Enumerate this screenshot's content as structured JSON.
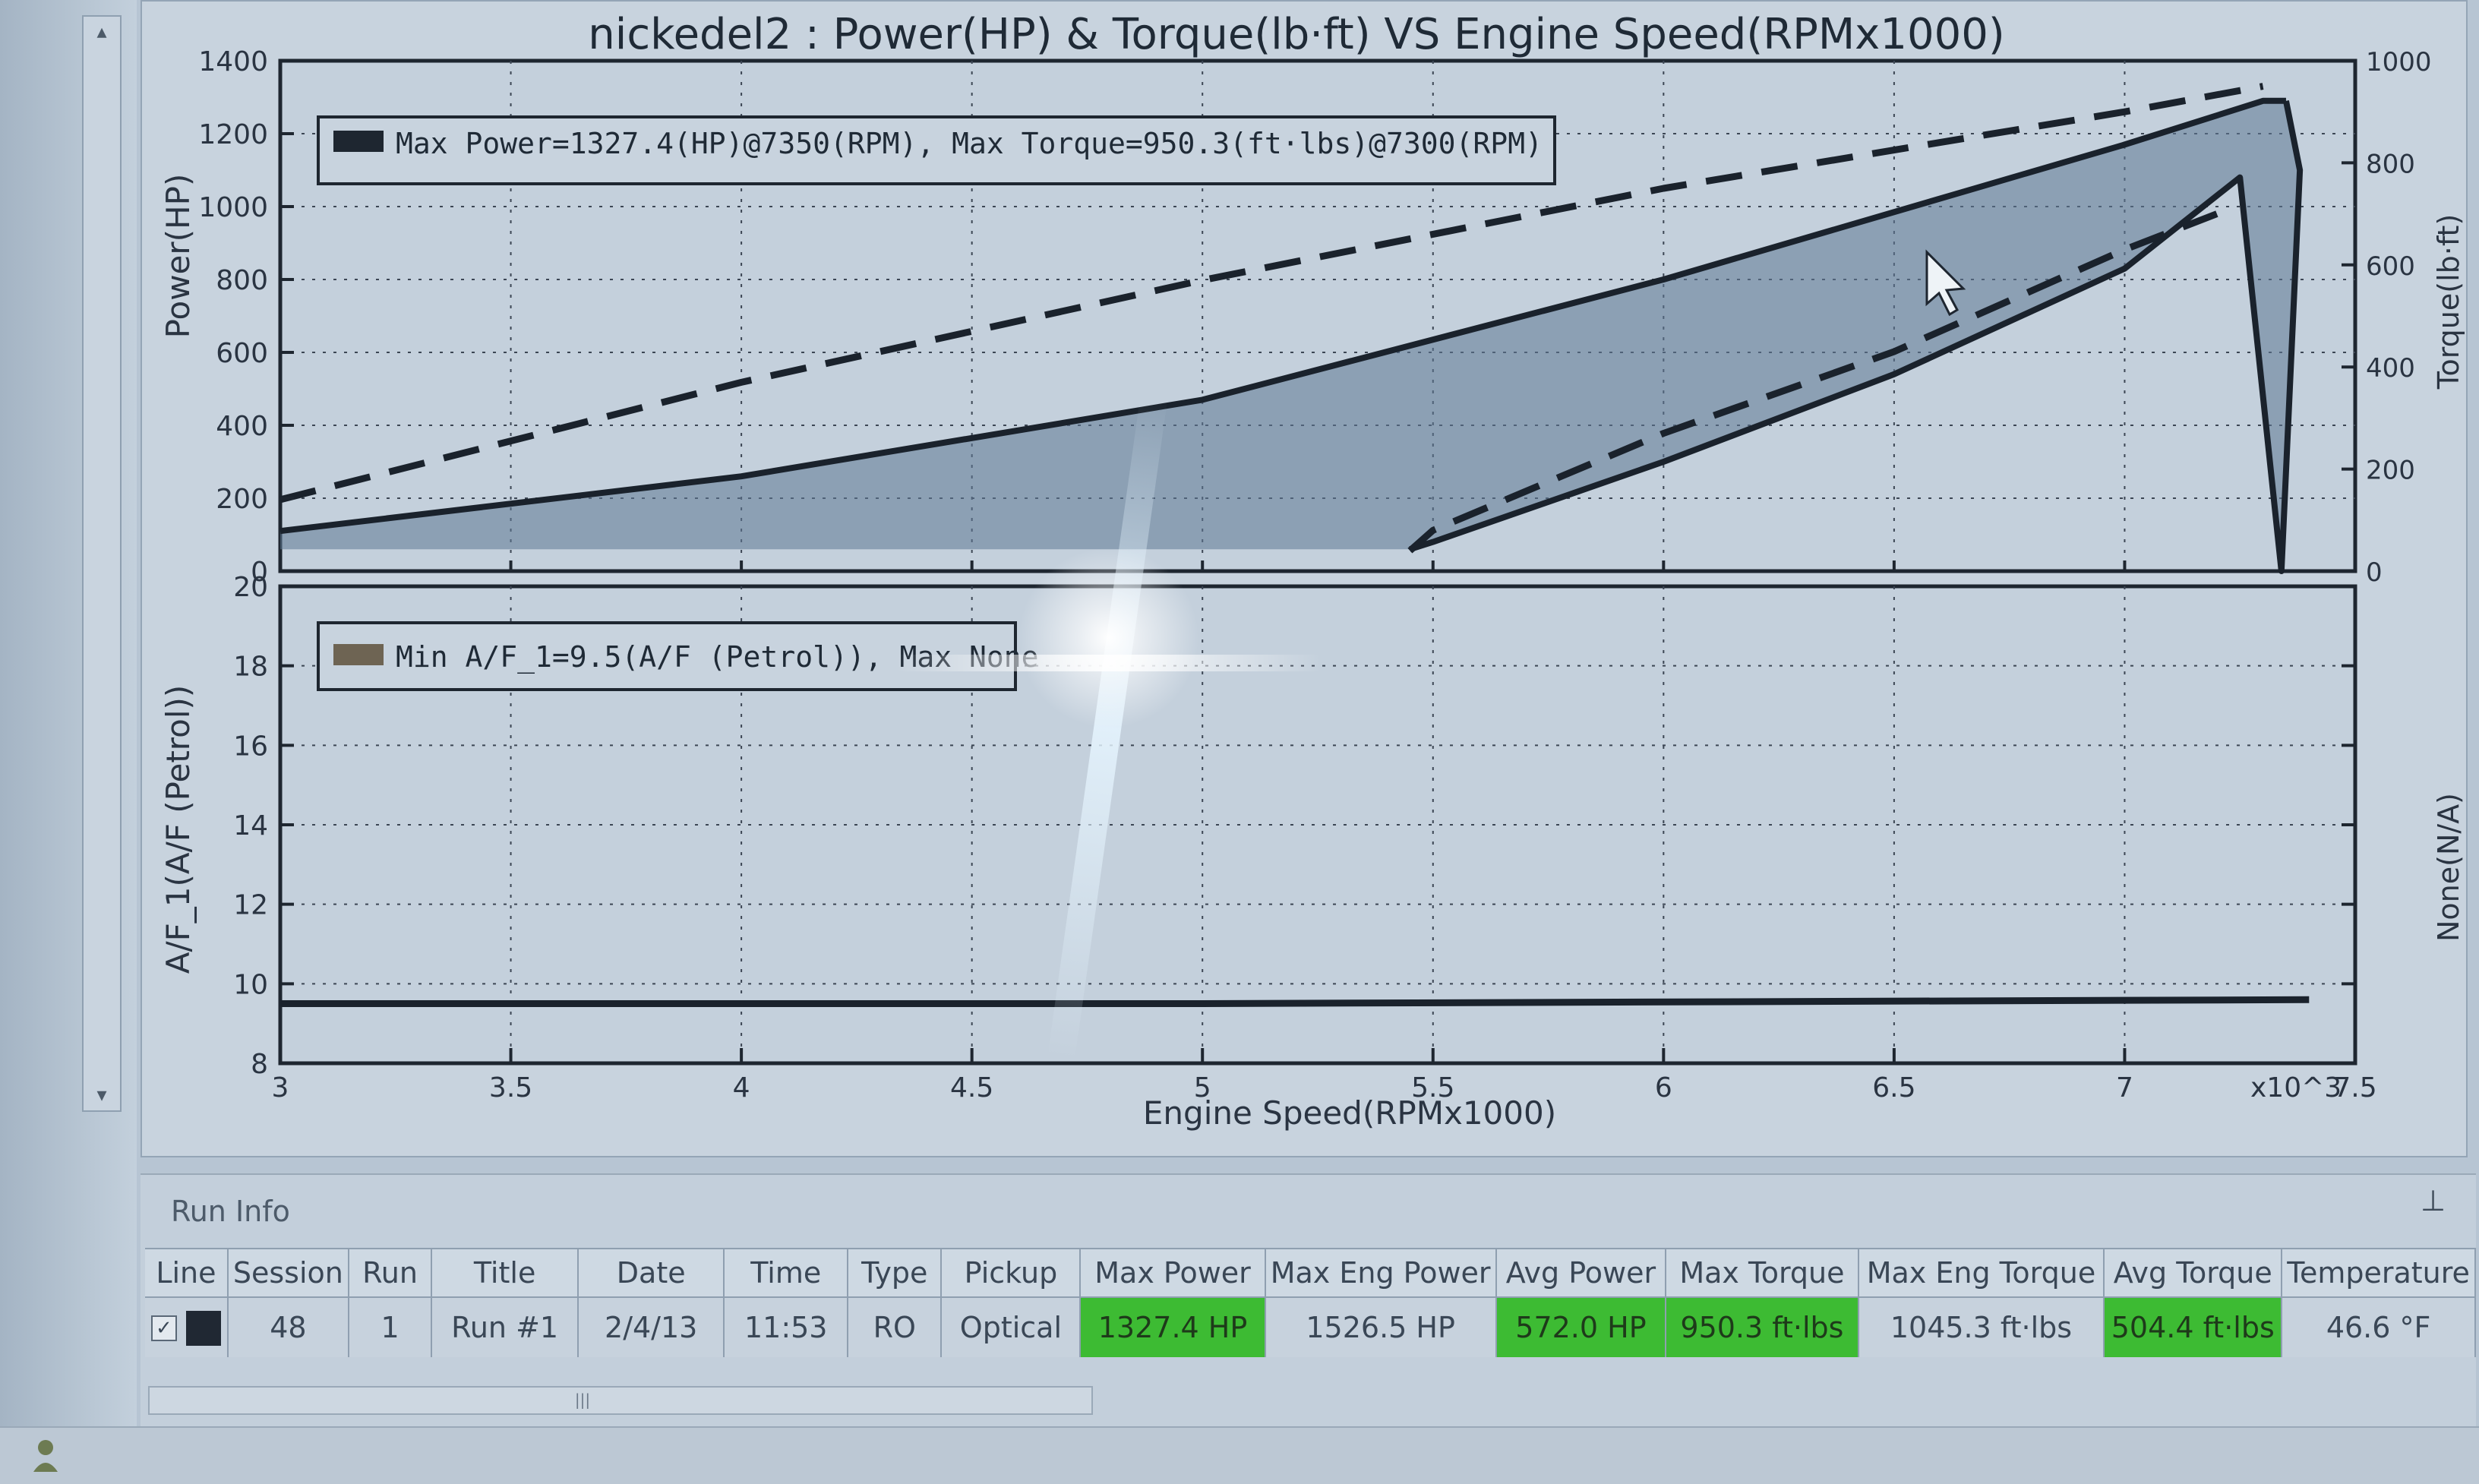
{
  "window": {
    "left_scroll_up": "▴",
    "left_scroll_down": "▾"
  },
  "chart_data": {
    "type": "line",
    "title": "nickedel2 : Power(HP) & Torque(lb·ft) VS Engine Speed(RPMx1000)",
    "xlabel": "Engine Speed(RPMx1000)",
    "x_ticks": [
      "3",
      "3.5",
      "4",
      "4.5",
      "5",
      "5.5",
      "6",
      "6.5",
      "7",
      "7.5"
    ],
    "x_exponent_label": "x10^3",
    "xlim": [
      3,
      7.5
    ],
    "grid": true,
    "top_panel": {
      "ylabel_left": "Power(HP)",
      "ylabel_right": "Torque(lb·ft)",
      "ylim_left": [
        0,
        1400
      ],
      "ylim_right": [
        0,
        1000
      ],
      "left_ticks": [
        "0",
        "200",
        "400",
        "600",
        "800",
        "1000",
        "1200",
        "1400"
      ],
      "right_ticks": [
        "0",
        "200",
        "400",
        "600",
        "800",
        "1000"
      ],
      "legend": "Max Power=1327.4(HP)@7350(RPM), Max Torque=950.3(ft·lbs)@7300(RPM)",
      "legend_position": "top-left",
      "series": [
        {
          "name": "power_sweep_up",
          "style": "solid",
          "x": [
            3.0,
            4.0,
            5.0,
            6.0,
            7.0,
            7.3,
            7.35
          ],
          "y": [
            110,
            260,
            470,
            800,
            1170,
            1290,
            1290
          ]
        },
        {
          "name": "torque_sweep_up",
          "style": "dashed",
          "axis": "right",
          "x": [
            3.0,
            4.0,
            5.0,
            6.0,
            7.0,
            7.3
          ],
          "y": [
            140,
            370,
            570,
            750,
            900,
            950
          ]
        },
        {
          "name": "power_sweep_down",
          "style": "solid",
          "x": [
            7.35,
            7.38,
            7.34,
            7.25,
            7.0,
            6.5,
            6.0,
            5.5,
            5.45
          ],
          "y": [
            1290,
            1100,
            0,
            1080,
            830,
            540,
            300,
            80,
            60
          ]
        },
        {
          "name": "torque_sweep_down",
          "style": "dashed",
          "axis": "right",
          "x": [
            7.2,
            7.0,
            6.5,
            6.0,
            5.5,
            5.45
          ],
          "y": [
            700,
            630,
            430,
            270,
            80,
            40
          ]
        }
      ]
    },
    "bottom_panel": {
      "ylabel_left": "A/F_1(A/F (Petrol))",
      "ylabel_right": "None(N/A)",
      "ylim": [
        8,
        20
      ],
      "left_ticks": [
        "8",
        "10",
        "12",
        "14",
        "16",
        "18",
        "20"
      ],
      "legend": "Min A/F_1=9.5(A/F (Petrol)), Max None",
      "legend_position": "top-left",
      "series": [
        {
          "name": "af_1",
          "style": "solid",
          "x": [
            3.0,
            5.0,
            7.4
          ],
          "y": [
            9.5,
            9.5,
            9.6
          ]
        }
      ]
    }
  },
  "run_info": {
    "panel_title": "Run Info",
    "pin_icon": "⊥",
    "columns": [
      "Line",
      "Session",
      "Run",
      "Title",
      "Date",
      "Time",
      "Type",
      "Pickup",
      "Max Power",
      "Max Eng Power",
      "Avg Power",
      "Max Torque",
      "Max Eng Torque",
      "Avg Torque",
      "Temperature"
    ],
    "row": {
      "checked": "✓",
      "session": "48",
      "run": "1",
      "title": "Run #1",
      "date": "2/4/13",
      "time": "11:53",
      "type": "RO",
      "pickup": "Optical",
      "max_power": "1327.4 HP",
      "max_eng_power": "1526.5 HP",
      "avg_power": "572.0 HP",
      "max_torque": "950.3 ft·lbs",
      "max_eng_torque": "1045.3 ft·lbs",
      "avg_torque": "504.4 ft·lbs",
      "temperature": "46.6 °F"
    },
    "scroll_thumb": "|||",
    "highlight_color": "#3dbb33"
  }
}
